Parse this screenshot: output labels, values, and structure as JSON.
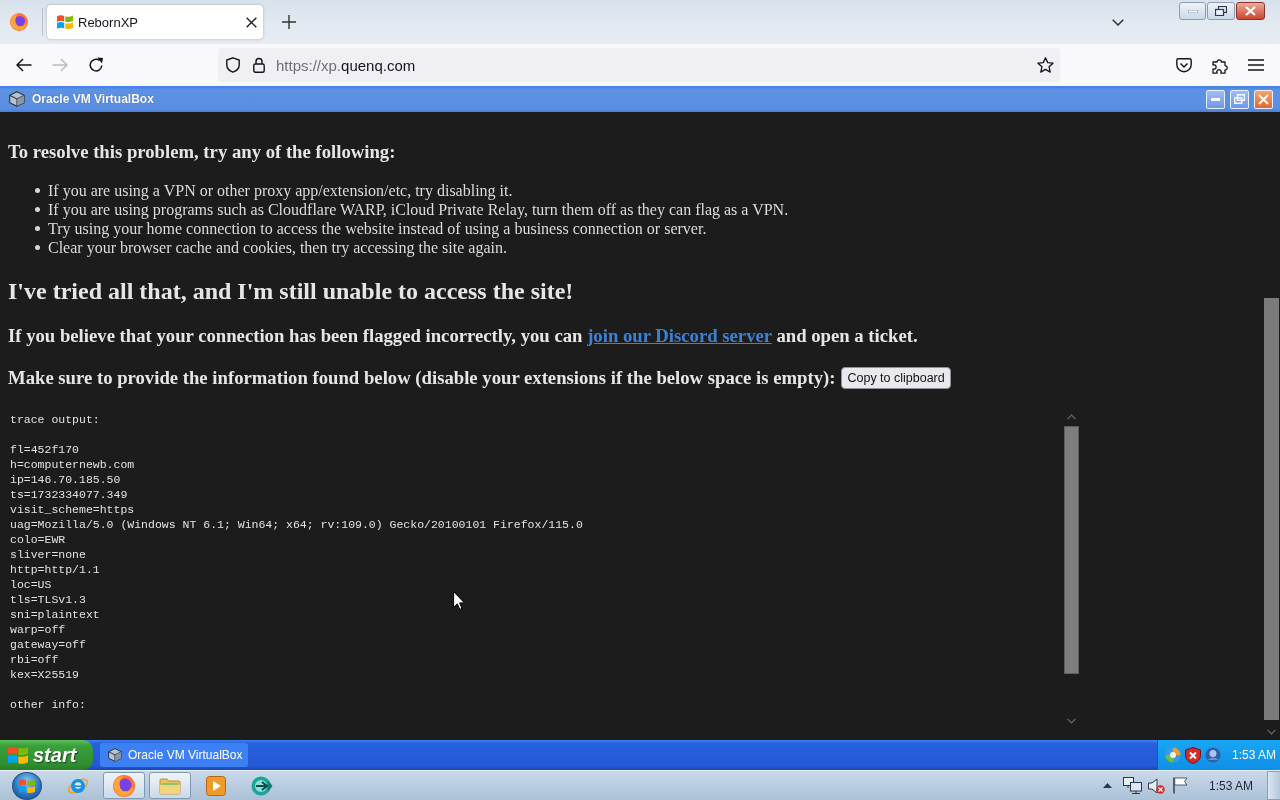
{
  "browser": {
    "tabs": [
      {
        "title": "RebornXP",
        "selected": true
      }
    ],
    "forward_disabled": true,
    "address": {
      "dim": "https://xp.",
      "main": "quenq.com"
    }
  },
  "vm_window": {
    "title": "Oracle VM VirtualBox"
  },
  "page": {
    "resolve_heading": "To resolve this problem, try any of the following:",
    "steps": [
      "If you are using a VPN or other proxy app/extension/etc, try disabling it.",
      "If you are using programs such as Cloudflare WARP, iCloud Private Relay, turn them off as they can flag as a VPN.",
      "Try using your home connection to access the website instead of using a business connection or server.",
      "Clear your browser cache and cookies, then try accessing the site again."
    ],
    "heading": "I've tried all that, and I'm still unable to access the site!",
    "contact": {
      "before": "If you believe that your connection has been flagged incorrectly, you can",
      "link": "join our Discord server",
      "after": "and open a ticket."
    },
    "info_prompt": "Make sure to provide the information found below (disable your extensions if the below space is empty):",
    "copy_button": "Copy to clipboard",
    "trace_sections": [
      {
        "title": "trace output:",
        "lines": [
          "fl=452f170",
          "h=computernewb.com",
          "ip=146.70.185.50",
          "ts=1732334077.349",
          "visit_scheme=https",
          "uag=Mozilla/5.0 (Windows NT 6.1; Win64; x64; rv:109.0) Gecko/20100101 Firefox/115.0",
          "colo=EWR",
          "sliver=none",
          "http=http/1.1",
          "loc=US",
          "tls=TLSv1.3",
          "sni=plaintext",
          "warp=off",
          "gateway=off",
          "rbi=off",
          "kex=X25519"
        ]
      },
      {
        "title": "other info:"
      }
    ]
  },
  "xp_taskbar": {
    "start": "start",
    "tasks": [
      {
        "label": "Oracle VM VirtualBox",
        "selected": false
      }
    ],
    "clock": "1:53 AM"
  },
  "host_taskbar": {
    "apps": [
      {
        "kind": "explorer",
        "open": false
      },
      {
        "kind": "browser",
        "open": true
      },
      {
        "kind": "files",
        "open": true
      },
      {
        "kind": "player",
        "open": false
      },
      {
        "kind": "media",
        "open": false
      }
    ],
    "clock": "1:53 AM"
  }
}
